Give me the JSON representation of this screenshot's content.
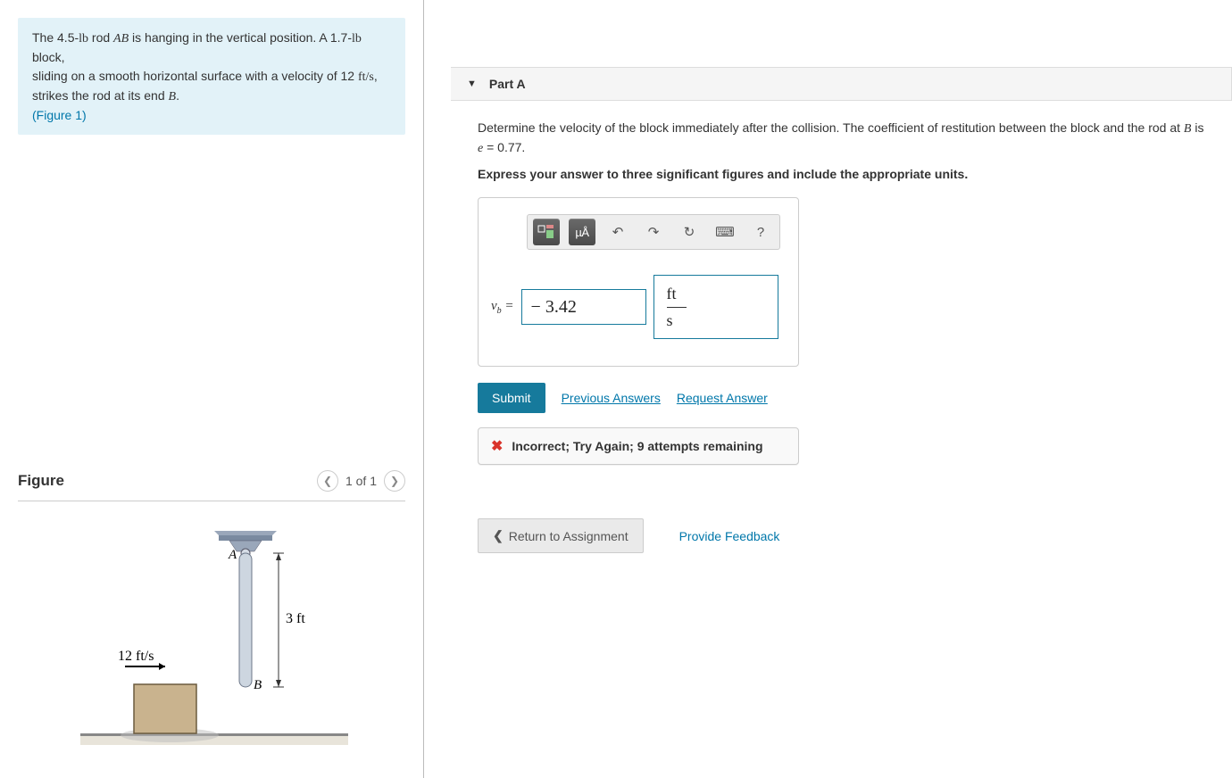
{
  "problem": {
    "rod_weight": "4.5",
    "rod_unit": "lb",
    "rod_name": "AB",
    "block_weight": "1.7",
    "block_unit": "lb",
    "velocity": "12",
    "velocity_unit": "ft/s",
    "end_point": "B",
    "figure_ref": "(Figure 1)",
    "line1a": "The 4.5-",
    "line1b": " rod ",
    "line1c": " is hanging in the vertical position. A 1.7-",
    "line1d": " block,",
    "line2a": "sliding on a smooth horizontal surface with a velocity of 12 ",
    "line2b": ",",
    "line3a": "strikes the rod at its end ",
    "line3b": "."
  },
  "figure": {
    "title": "Figure",
    "pager": "1 of 1",
    "label_A": "A",
    "label_B": "B",
    "length": "3 ft",
    "velocity_label": "12 ft/s"
  },
  "part": {
    "title": "Part A",
    "question_a": "Determine the velocity of the block immediately after the collision. The coefficient of restitution between the block and the rod at ",
    "question_point": "B",
    "question_b": " is ",
    "e_var": "e",
    "e_val": " = 0.77.",
    "instruction": "Express your answer to three significant figures and include the appropriate units."
  },
  "toolbar": {
    "templates_icon": "▭",
    "units_btn": "µÅ",
    "undo": "↶",
    "redo": "↷",
    "reset": "↻",
    "keyboard": "⌨",
    "help": "?"
  },
  "answer": {
    "var": "v",
    "sub": "b",
    "eq": " =",
    "value": "− 3.42",
    "unit_num": "ft",
    "unit_den": "s"
  },
  "actions": {
    "submit": "Submit",
    "previous": "Previous Answers",
    "request": "Request Answer"
  },
  "feedback": {
    "text": "Incorrect; Try Again; 9 attempts remaining"
  },
  "bottom": {
    "return": "Return to Assignment",
    "provide": "Provide Feedback"
  }
}
